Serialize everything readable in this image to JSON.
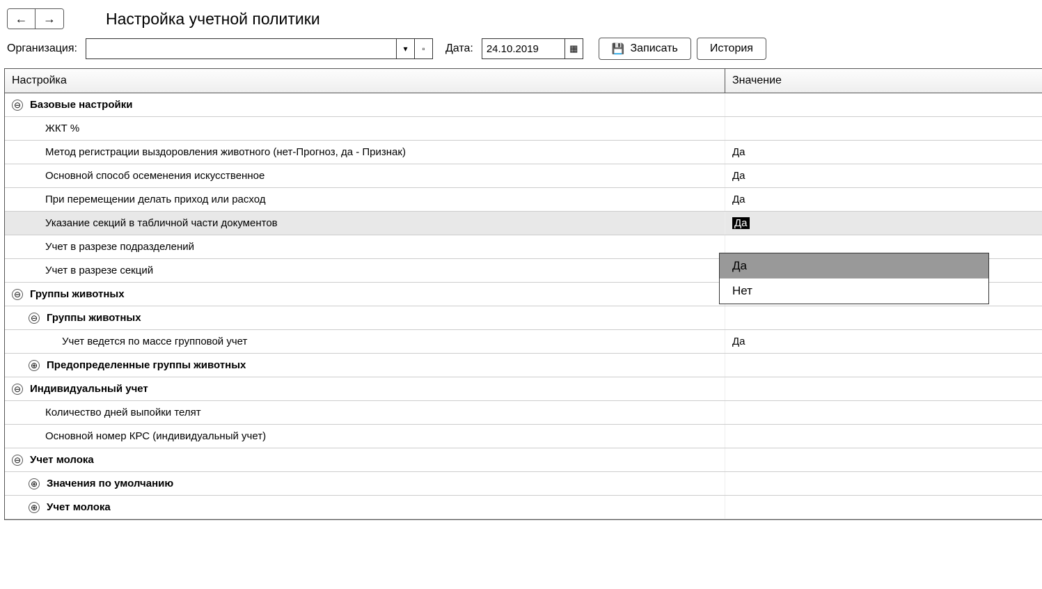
{
  "title": "Настройка учетной политики",
  "labels": {
    "org": "Организация:",
    "date": "Дата:"
  },
  "date_value": "24.10.2019",
  "buttons": {
    "save": "Записать",
    "history": "История"
  },
  "columns": {
    "setting": "Настройка",
    "value": "Значение"
  },
  "rows": [
    {
      "type": "group",
      "expanded": true,
      "indent": 1,
      "label": "Базовые настройки",
      "value": ""
    },
    {
      "type": "item",
      "indent": 3,
      "label": "ЖКТ %",
      "value": ""
    },
    {
      "type": "item",
      "indent": 3,
      "label": "Метод регистрации выздоровления животного (нет-Прогноз, да - Признак)",
      "value": "Да"
    },
    {
      "type": "item",
      "indent": 3,
      "label": "Основной способ осеменения искусственное",
      "value": "Да"
    },
    {
      "type": "item",
      "indent": 3,
      "label": "При перемещении делать приход или расход",
      "value": "Да"
    },
    {
      "type": "item",
      "indent": 3,
      "label": "Указание секций в табличной части документов",
      "value": "Да",
      "selected": true,
      "editing": true
    },
    {
      "type": "item",
      "indent": 3,
      "label": "Учет в разрезе подразделений",
      "value": ""
    },
    {
      "type": "item",
      "indent": 3,
      "label": "Учет в разрезе секций",
      "value": ""
    },
    {
      "type": "group",
      "expanded": true,
      "indent": 1,
      "label": "Группы животных",
      "value": ""
    },
    {
      "type": "group",
      "expanded": true,
      "indent": 2,
      "label": "Группы животных",
      "value": ""
    },
    {
      "type": "item",
      "indent": 4,
      "label": "Учет ведется по массе групповой учет",
      "value": "Да"
    },
    {
      "type": "group",
      "expanded": false,
      "indent": 2,
      "label": "Предопределенные группы животных",
      "value": ""
    },
    {
      "type": "group",
      "expanded": true,
      "indent": 1,
      "label": "Индивидуальный учет",
      "value": ""
    },
    {
      "type": "item",
      "indent": 3,
      "label": "Количество дней выпойки телят",
      "value": ""
    },
    {
      "type": "item",
      "indent": 3,
      "label": "Основной номер КРС (индивидуальный учет)",
      "value": ""
    },
    {
      "type": "group",
      "expanded": true,
      "indent": 1,
      "label": "Учет молока",
      "value": ""
    },
    {
      "type": "group",
      "expanded": false,
      "indent": 2,
      "label": "Значения по умолчанию",
      "value": ""
    },
    {
      "type": "group",
      "expanded": false,
      "indent": 2,
      "label": "Учет молока",
      "value": ""
    }
  ],
  "dropdown": {
    "options": [
      "Да",
      "Нет"
    ],
    "selected": 0
  }
}
